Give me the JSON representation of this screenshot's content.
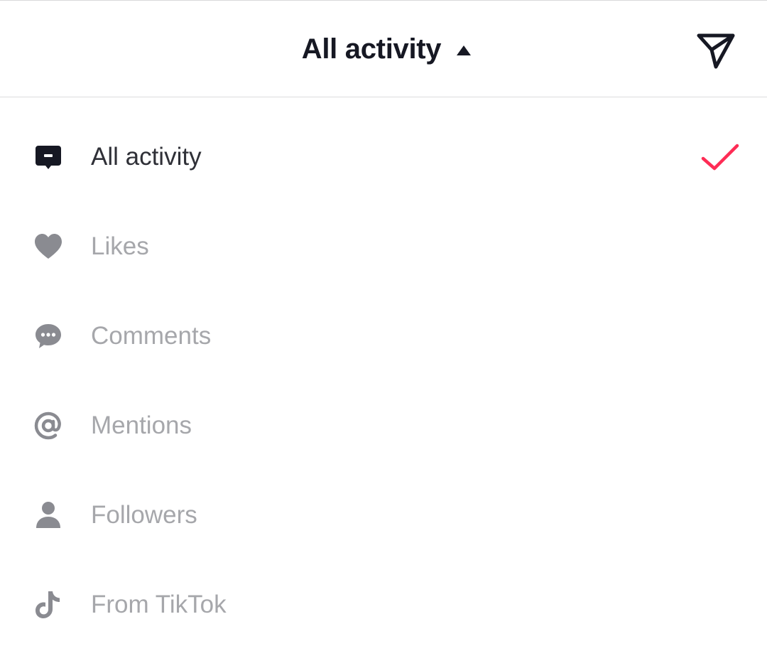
{
  "header": {
    "title": "All activity",
    "dropdown_state": "expanded"
  },
  "menu": {
    "items": [
      {
        "label": "All activity",
        "icon": "message-square-icon",
        "selected": true
      },
      {
        "label": "Likes",
        "icon": "heart-icon",
        "selected": false
      },
      {
        "label": "Comments",
        "icon": "comment-bubble-icon",
        "selected": false
      },
      {
        "label": "Mentions",
        "icon": "at-sign-icon",
        "selected": false
      },
      {
        "label": "Followers",
        "icon": "person-icon",
        "selected": false
      },
      {
        "label": "From TikTok",
        "icon": "tiktok-logo-icon",
        "selected": false
      }
    ]
  },
  "colors": {
    "selected_text": "#2f3037",
    "unselected_text": "#a6a7ab",
    "selected_icon": "#161823",
    "unselected_icon": "#8a8b91",
    "check": "#fe2c55",
    "title": "#161823"
  }
}
